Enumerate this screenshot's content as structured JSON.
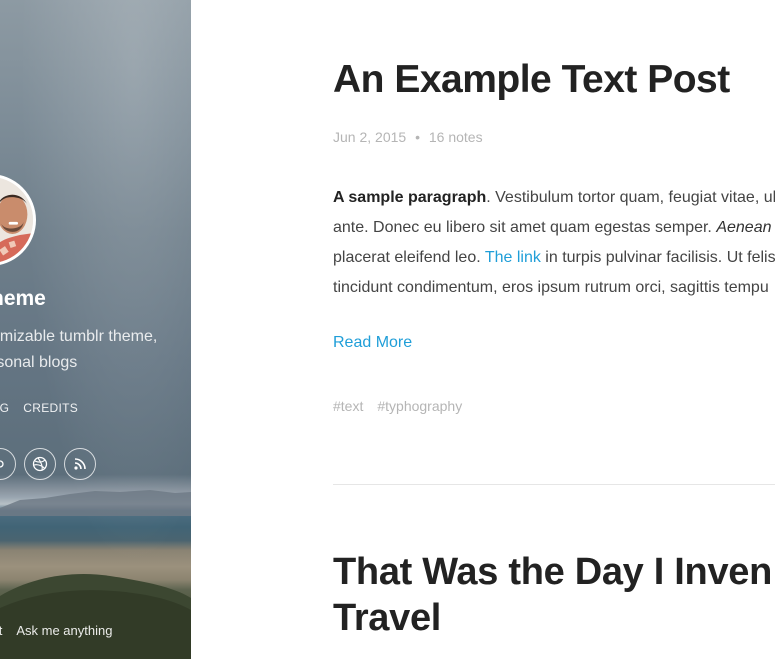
{
  "sidebar": {
    "title": "heme",
    "description_lines": [
      "omizable tumblr theme,",
      "rsonal blogs"
    ],
    "nav": [
      "OG",
      "CREDITS"
    ],
    "social_icons": [
      "social-icon-partial",
      "dribbble-icon",
      "rss-icon"
    ],
    "footer_links": [
      "mit",
      "Ask me anything"
    ]
  },
  "post1": {
    "title": "An Example Text Post",
    "date": "Jun 2, 2015",
    "separator": "•",
    "notes": "16 notes",
    "body": {
      "line1_bold": "A sample paragraph",
      "line1_rest": ". Vestibulum tortor quam, feugiat vitae, ul",
      "line2_plain": "ante. Donec eu libero sit amet quam egestas semper. ",
      "line2_italic": "Aenean u",
      "line3_pre": "placerat eleifend leo. ",
      "line3_link": "The link",
      "line3_post": " in turpis pulvinar facilisis. Ut felis",
      "line4": "tincidunt condimentum, eros ipsum rutrum orci, sagittis tempu"
    },
    "read_more": "Read More",
    "tags": [
      "#text",
      "#typhography"
    ]
  },
  "post2": {
    "title_lines": [
      "That Was the Day I Inven",
      "Travel"
    ]
  },
  "colors": {
    "link": "#1f9ed8",
    "meta": "#b5b5b5",
    "title": "#222222"
  }
}
